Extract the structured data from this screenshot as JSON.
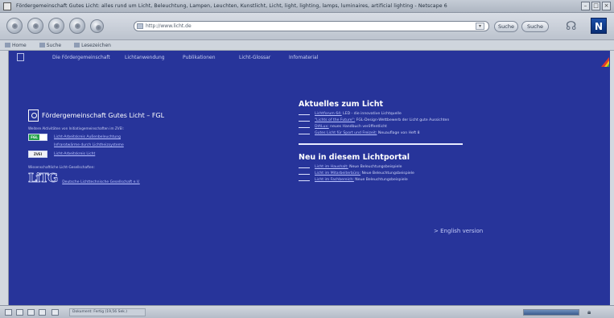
{
  "window": {
    "title": "Fördergemeinschaft Gutes Licht: alles rund um Licht, Beleuchtung, Lampen, Leuchten, Kunstlicht, Licht, light, lighting, lamps, luminaires, artificial lighting - Netscape 6"
  },
  "toolbar": {
    "url": "http://www.licht.de",
    "search_label": "Suche",
    "search_button": "Suche"
  },
  "personal_bar": {
    "items": [
      "Home",
      "Suche",
      "Lesezeichen"
    ]
  },
  "site_nav": {
    "items": [
      "Die Fördergemeinschaft",
      "Lichtanwendung",
      "Publikationen",
      "Licht-Glossar",
      "Infomaterial"
    ]
  },
  "fgl": {
    "title": "Fördergemeinschaft Gutes Licht – FGL",
    "member_text": "Weitere Aktivitäten von Initiativgemeinschaften im ZVEI:",
    "links": [
      "Licht-Arbeitskreis Außenbeleuchtung",
      "Infrarotwärme durch Lichtheizsysteme",
      "Licht-Arbeitskreis Licht",
      "Deutsche Lichttechnische Gesellschaft e.V."
    ],
    "badges": [
      "FGL",
      "ZVEI"
    ],
    "partner_text": "Wissenschaftliche Licht-Gesellschaften:",
    "litg_logo": "LiTG"
  },
  "news": {
    "heading": "Aktuelles zum Licht",
    "items": [
      {
        "link": "Lichtforum 64:",
        "text": " LED - die innovative Lichtquelle"
      },
      {
        "link": "\"Lichts of the Future\":",
        "text": " FGL-Design-Wettbewerb der Licht gute Aussichten"
      },
      {
        "link": "DIALux:",
        "text": " neues Handbuch veröffentlicht"
      },
      {
        "link": "Gutes Licht für Sport und Freizeit:",
        "text": " Neuauflage von Heft 8"
      }
    ]
  },
  "portal": {
    "heading": "Neu in diesem Lichtportal",
    "items": [
      {
        "link": "Licht im Haushalt:",
        "text": " Neue Beleuchtungsbeispiele"
      },
      {
        "link": "Licht im Mitarbeiterbüro:",
        "text": " Neue Beleuchtungsbeispiele"
      },
      {
        "link": "Licht im Fachbereich:",
        "text": " Neue Beleuchtungsbeispiele"
      }
    ]
  },
  "english_link": "> English version",
  "status": {
    "text": "Dokument: Fertig (19,56 Sek.)",
    "progress": 1.0
  }
}
